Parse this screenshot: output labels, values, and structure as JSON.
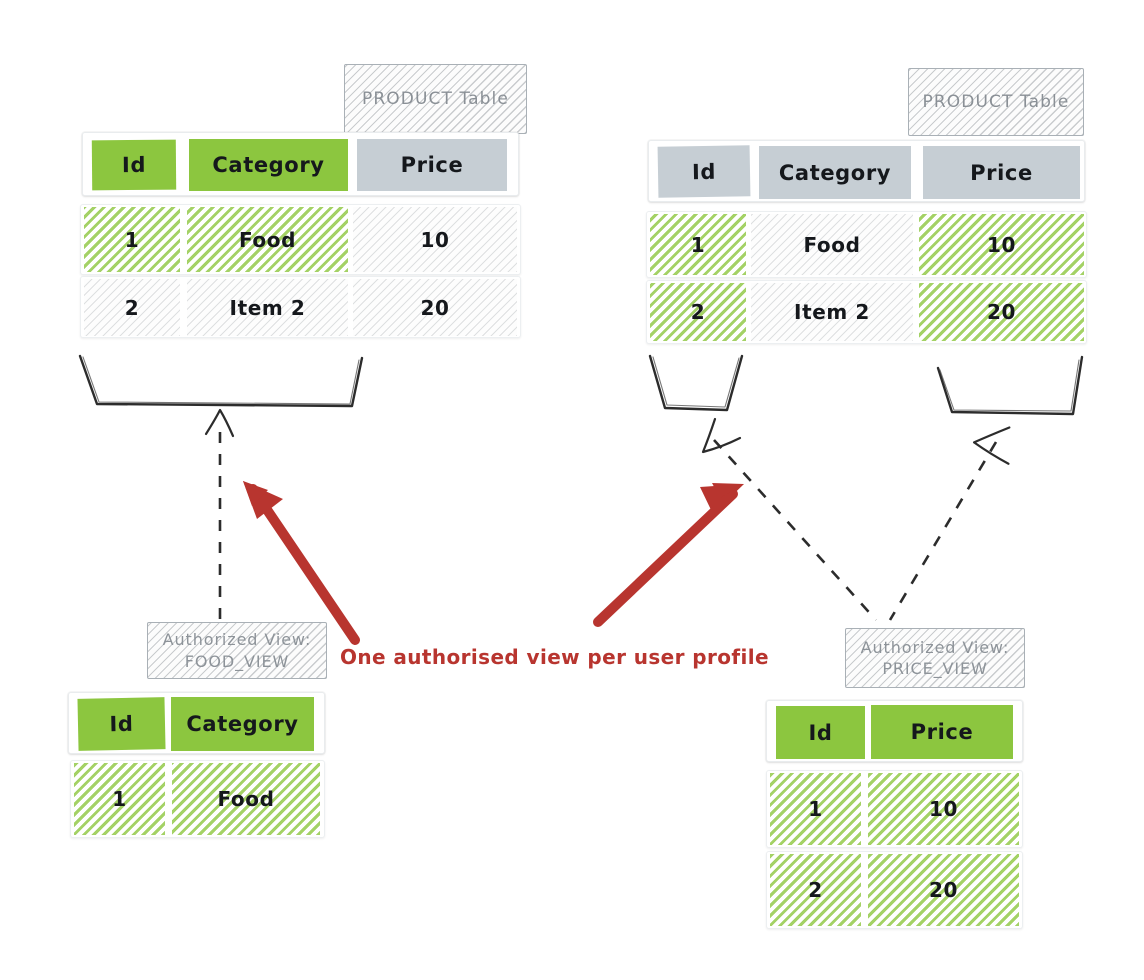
{
  "diagram": {
    "title_annotation": "One authorised view per user profile",
    "annotation_color": "#b8352f",
    "accent_green": "#8cc63f",
    "accent_gray": "#c6ced4"
  },
  "tables": {
    "product_left": {
      "title": "PRODUCT Table",
      "columns": [
        {
          "label": "Id",
          "fill": "green"
        },
        {
          "label": "Category",
          "fill": "green"
        },
        {
          "label": "Price",
          "fill": "gray"
        }
      ],
      "rows": [
        {
          "cells": [
            {
              "value": "1",
              "hatch": "green"
            },
            {
              "value": "Food",
              "hatch": "green"
            },
            {
              "value": "10",
              "hatch": "gray"
            }
          ]
        },
        {
          "cells": [
            {
              "value": "2",
              "hatch": "gray"
            },
            {
              "value": "Item 2",
              "hatch": "gray"
            },
            {
              "value": "20",
              "hatch": "gray"
            }
          ]
        }
      ]
    },
    "product_right": {
      "title": "PRODUCT Table",
      "columns": [
        {
          "label": "Id",
          "fill": "gray"
        },
        {
          "label": "Category",
          "fill": "gray"
        },
        {
          "label": "Price",
          "fill": "gray"
        }
      ],
      "rows": [
        {
          "cells": [
            {
              "value": "1",
              "hatch": "green"
            },
            {
              "value": "Food",
              "hatch": "gray"
            },
            {
              "value": "10",
              "hatch": "green"
            }
          ]
        },
        {
          "cells": [
            {
              "value": "2",
              "hatch": "green"
            },
            {
              "value": "Item 2",
              "hatch": "gray"
            },
            {
              "value": "20",
              "hatch": "green"
            }
          ]
        }
      ]
    },
    "food_view": {
      "title": "Authorized View:\nFOOD_VIEW",
      "title_line1": "Authorized View:",
      "title_line2": "FOOD_VIEW",
      "columns": [
        {
          "label": "Id",
          "fill": "green"
        },
        {
          "label": "Category",
          "fill": "green"
        }
      ],
      "rows": [
        {
          "cells": [
            {
              "value": "1",
              "hatch": "green"
            },
            {
              "value": "Food",
              "hatch": "green"
            }
          ]
        }
      ]
    },
    "price_view": {
      "title": "Authorized View:\nPRICE_VIEW",
      "title_line1": "Authorized View:",
      "title_line2": "PRICE_VIEW",
      "columns": [
        {
          "label": "Id",
          "fill": "green"
        },
        {
          "label": "Price",
          "fill": "green"
        }
      ],
      "rows": [
        {
          "cells": [
            {
              "value": "1",
              "hatch": "green"
            },
            {
              "value": "10",
              "hatch": "green"
            }
          ]
        },
        {
          "cells": [
            {
              "value": "2",
              "hatch": "green"
            },
            {
              "value": "20",
              "hatch": "green"
            }
          ]
        }
      ]
    }
  }
}
